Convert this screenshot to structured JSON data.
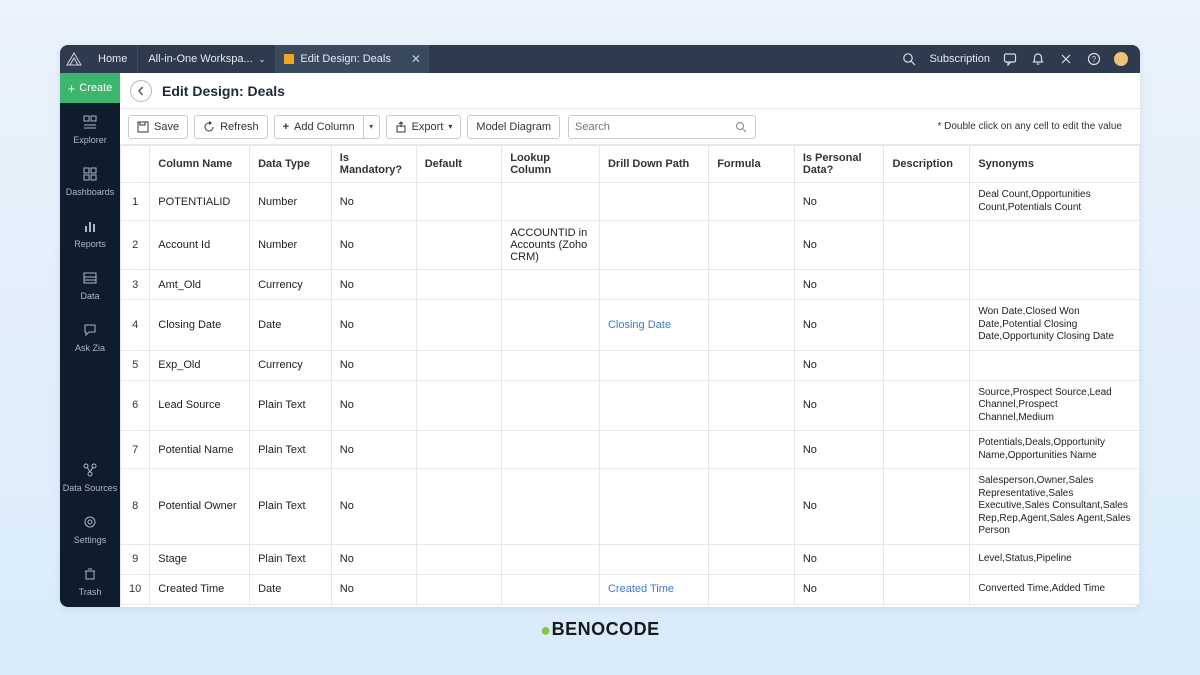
{
  "topbar": {
    "home": "Home",
    "workspace": "All-in-One Workspa...",
    "tab_label": "Edit Design: Deals",
    "subscription": "Subscription"
  },
  "sidebar": {
    "create": "Create",
    "items": [
      {
        "label": "Explorer"
      },
      {
        "label": "Dashboards"
      },
      {
        "label": "Reports"
      },
      {
        "label": "Data"
      },
      {
        "label": "Ask Zia"
      }
    ],
    "bottom": [
      {
        "label": "Data Sources"
      },
      {
        "label": "Settings"
      },
      {
        "label": "Trash"
      }
    ]
  },
  "page": {
    "title": "Edit Design:  Deals"
  },
  "toolbar": {
    "save": "Save",
    "refresh": "Refresh",
    "add_column": "Add Column",
    "export": "Export",
    "model": "Model Diagram",
    "search_placeholder": "Search",
    "hint": "* Double click on any cell to edit the value"
  },
  "columns": [
    "",
    "Column Name",
    "Data Type",
    "Is Mandatory?",
    "Default",
    "Lookup Column",
    "Drill Down Path",
    "Formula",
    "Is Personal Data?",
    "Description",
    "Synonyms"
  ],
  "rows": [
    {
      "n": "1",
      "name": "POTENTIALID",
      "type": "Number",
      "mand": "No",
      "def": "",
      "look": "",
      "drill": "",
      "form": "",
      "pers": "No",
      "desc": "",
      "syn": "Deal Count,Opportunities Count,Potentials Count"
    },
    {
      "n": "2",
      "name": "Account Id",
      "type": "Number",
      "mand": "No",
      "def": "",
      "look": "ACCOUNTID in Accounts (Zoho CRM)",
      "drill": "",
      "form": "",
      "pers": "No",
      "desc": "",
      "syn": ""
    },
    {
      "n": "3",
      "name": "Amt_Old",
      "type": "Currency",
      "mand": "No",
      "def": "",
      "look": "",
      "drill": "",
      "form": "",
      "pers": "No",
      "desc": "",
      "syn": ""
    },
    {
      "n": "4",
      "name": "Closing Date",
      "type": "Date",
      "mand": "No",
      "def": "",
      "look": "",
      "drill": "Closing Date",
      "drill_link": true,
      "form": "",
      "pers": "No",
      "desc": "",
      "syn": "Won Date,Closed Won Date,Potential Closing Date,Opportunity Closing Date"
    },
    {
      "n": "5",
      "name": "Exp_Old",
      "type": "Currency",
      "mand": "No",
      "def": "",
      "look": "",
      "drill": "",
      "form": "",
      "pers": "No",
      "desc": "",
      "syn": ""
    },
    {
      "n": "6",
      "name": "Lead Source",
      "type": "Plain Text",
      "mand": "No",
      "def": "",
      "look": "",
      "drill": "",
      "form": "",
      "pers": "No",
      "desc": "",
      "syn": "Source,Prospect Source,Lead Channel,Prospect Channel,Medium"
    },
    {
      "n": "7",
      "name": "Potential Name",
      "type": "Plain Text",
      "mand": "No",
      "def": "",
      "look": "",
      "drill": "",
      "form": "",
      "pers": "No",
      "desc": "",
      "syn": "Potentials,Deals,Opportunity Name,Opportunities Name"
    },
    {
      "n": "8",
      "name": "Potential Owner",
      "type": "Plain Text",
      "mand": "No",
      "def": "",
      "look": "",
      "drill": "",
      "form": "",
      "pers": "No",
      "desc": "",
      "syn": "Salesperson,Owner,Sales Representative,Sales Executive,Sales Consultant,Sales Rep,Rep,Agent,Sales Agent,Sales Person"
    },
    {
      "n": "9",
      "name": "Stage",
      "type": "Plain Text",
      "mand": "No",
      "def": "",
      "look": "",
      "drill": "",
      "form": "",
      "pers": "No",
      "desc": "",
      "syn": "Level,Status,Pipeline"
    },
    {
      "n": "10",
      "name": "Created Time",
      "type": "Date",
      "mand": "No",
      "def": "",
      "look": "",
      "drill": "Created Time",
      "drill_link": true,
      "form": "",
      "pers": "No",
      "desc": "",
      "syn": "Converted Time,Added Time"
    }
  ],
  "footer": "BENOCODE"
}
